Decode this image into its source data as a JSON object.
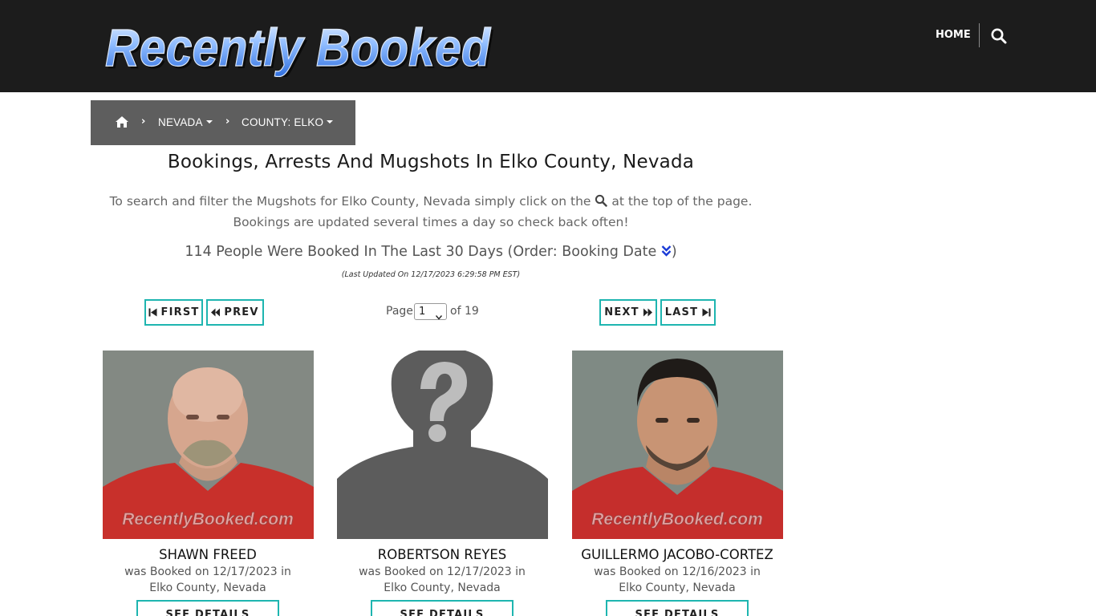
{
  "header": {
    "logo_text": "Recently Booked",
    "nav_home": "HOME",
    "search_icon": "search-icon"
  },
  "breadcrumb": {
    "home_icon": "home-icon",
    "state": "NEVADA",
    "county": "COUNTY: ELKO"
  },
  "page": {
    "title": "Bookings, Arrests And Mugshots In Elko County, Nevada",
    "intro_before": "To search and filter the Mugshots for Elko County, Nevada simply click on the",
    "intro_after": "at the top of the page. Bookings are updated several times a day so check back often!",
    "count_text": "114 People Were Booked In The Last 30 Days (Order: Booking Date",
    "count_close": ")",
    "last_updated": "(Last Updated On 12/17/2023 6:29:58 PM EST)"
  },
  "pagination": {
    "first": "FIRST",
    "prev": "PREV",
    "next": "NEXT",
    "last": "LAST",
    "page_label": "Page",
    "current_page": "1",
    "of_label": "of 19"
  },
  "colors": {
    "header_bg": "#1c1c1c",
    "breadcrumb_bg": "#5e5e5e",
    "accent": "#1eb5b0",
    "order_icon": "#1a3bd6"
  },
  "cards": [
    {
      "name": "SHAWN FREED",
      "booked_line": "was Booked on 12/17/2023 in",
      "location": "Elko County, Nevada",
      "watermark": "RecentlyBooked.com",
      "button": "SEE DETAILS"
    },
    {
      "name": "ROBERTSON REYES",
      "booked_line": "was Booked on 12/17/2023 in",
      "location": "Elko County, Nevada",
      "watermark": "",
      "button": "SEE DETAILS"
    },
    {
      "name": "GUILLERMO JACOBO-CORTEZ",
      "booked_line": "was Booked on 12/16/2023 in",
      "location": "Elko County, Nevada",
      "watermark": "RecentlyBooked.com",
      "button": "SEE DETAILS"
    }
  ]
}
